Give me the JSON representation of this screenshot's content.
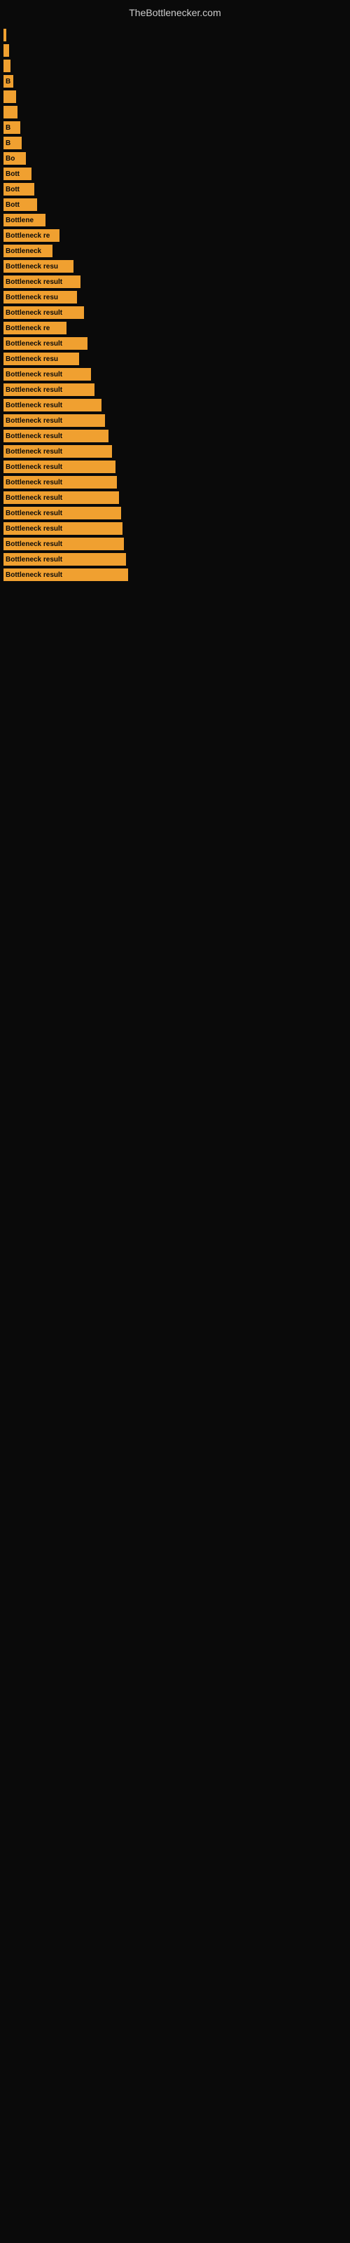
{
  "site": {
    "title": "TheBottlenecker.com"
  },
  "bars": [
    {
      "width": 4,
      "label": ""
    },
    {
      "width": 8,
      "label": ""
    },
    {
      "width": 10,
      "label": ""
    },
    {
      "width": 14,
      "label": "B"
    },
    {
      "width": 18,
      "label": ""
    },
    {
      "width": 20,
      "label": ""
    },
    {
      "width": 24,
      "label": "B"
    },
    {
      "width": 26,
      "label": "B"
    },
    {
      "width": 32,
      "label": "Bo"
    },
    {
      "width": 40,
      "label": "Bott"
    },
    {
      "width": 44,
      "label": "Bott"
    },
    {
      "width": 48,
      "label": "Bott"
    },
    {
      "width": 60,
      "label": "Bottlene"
    },
    {
      "width": 80,
      "label": "Bottleneck re"
    },
    {
      "width": 70,
      "label": "Bottleneck"
    },
    {
      "width": 100,
      "label": "Bottleneck resu"
    },
    {
      "width": 110,
      "label": "Bottleneck result"
    },
    {
      "width": 105,
      "label": "Bottleneck resu"
    },
    {
      "width": 115,
      "label": "Bottleneck result"
    },
    {
      "width": 90,
      "label": "Bottleneck re"
    },
    {
      "width": 120,
      "label": "Bottleneck result"
    },
    {
      "width": 108,
      "label": "Bottleneck resu"
    },
    {
      "width": 125,
      "label": "Bottleneck result"
    },
    {
      "width": 130,
      "label": "Bottleneck result"
    },
    {
      "width": 140,
      "label": "Bottleneck result"
    },
    {
      "width": 145,
      "label": "Bottleneck result"
    },
    {
      "width": 150,
      "label": "Bottleneck result"
    },
    {
      "width": 155,
      "label": "Bottleneck result"
    },
    {
      "width": 160,
      "label": "Bottleneck result"
    },
    {
      "width": 162,
      "label": "Bottleneck result"
    },
    {
      "width": 165,
      "label": "Bottleneck result"
    },
    {
      "width": 168,
      "label": "Bottleneck result"
    },
    {
      "width": 170,
      "label": "Bottleneck result"
    },
    {
      "width": 172,
      "label": "Bottleneck result"
    },
    {
      "width": 175,
      "label": "Bottleneck result"
    },
    {
      "width": 178,
      "label": "Bottleneck result"
    }
  ]
}
